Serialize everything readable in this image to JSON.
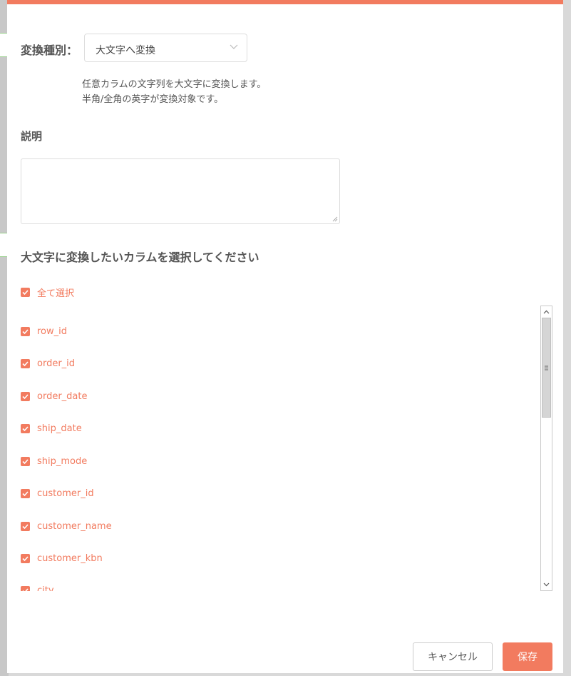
{
  "dialog": {
    "accent_color": "#f27b5f",
    "type_label": "変換種別：",
    "type_select_value": "大文字へ変換",
    "description_lines": [
      "任意カラムの文字列を大文字に変換します。",
      "半角/全角の英字が変換対象です。"
    ],
    "memo_label": "説明",
    "memo_value": "",
    "columns_title": "大文字に変換したいカラムを選択してください",
    "select_all_label": "全て選択",
    "columns": [
      {
        "label": "row_id",
        "checked": true
      },
      {
        "label": "order_id",
        "checked": true
      },
      {
        "label": "order_date",
        "checked": true
      },
      {
        "label": "ship_date",
        "checked": true
      },
      {
        "label": "ship_mode",
        "checked": true
      },
      {
        "label": "customer_id",
        "checked": true
      },
      {
        "label": "customer_name",
        "checked": true
      },
      {
        "label": "customer_kbn",
        "checked": true
      },
      {
        "label": "city",
        "checked": true
      }
    ],
    "cancel_label": "キャンセル",
    "save_label": "保存"
  },
  "icons": {
    "select_chevron": "chevron-down-icon",
    "checkbox_check": "check-icon",
    "scroll_up": "arrow-up-icon",
    "scroll_down": "arrow-down-icon"
  }
}
